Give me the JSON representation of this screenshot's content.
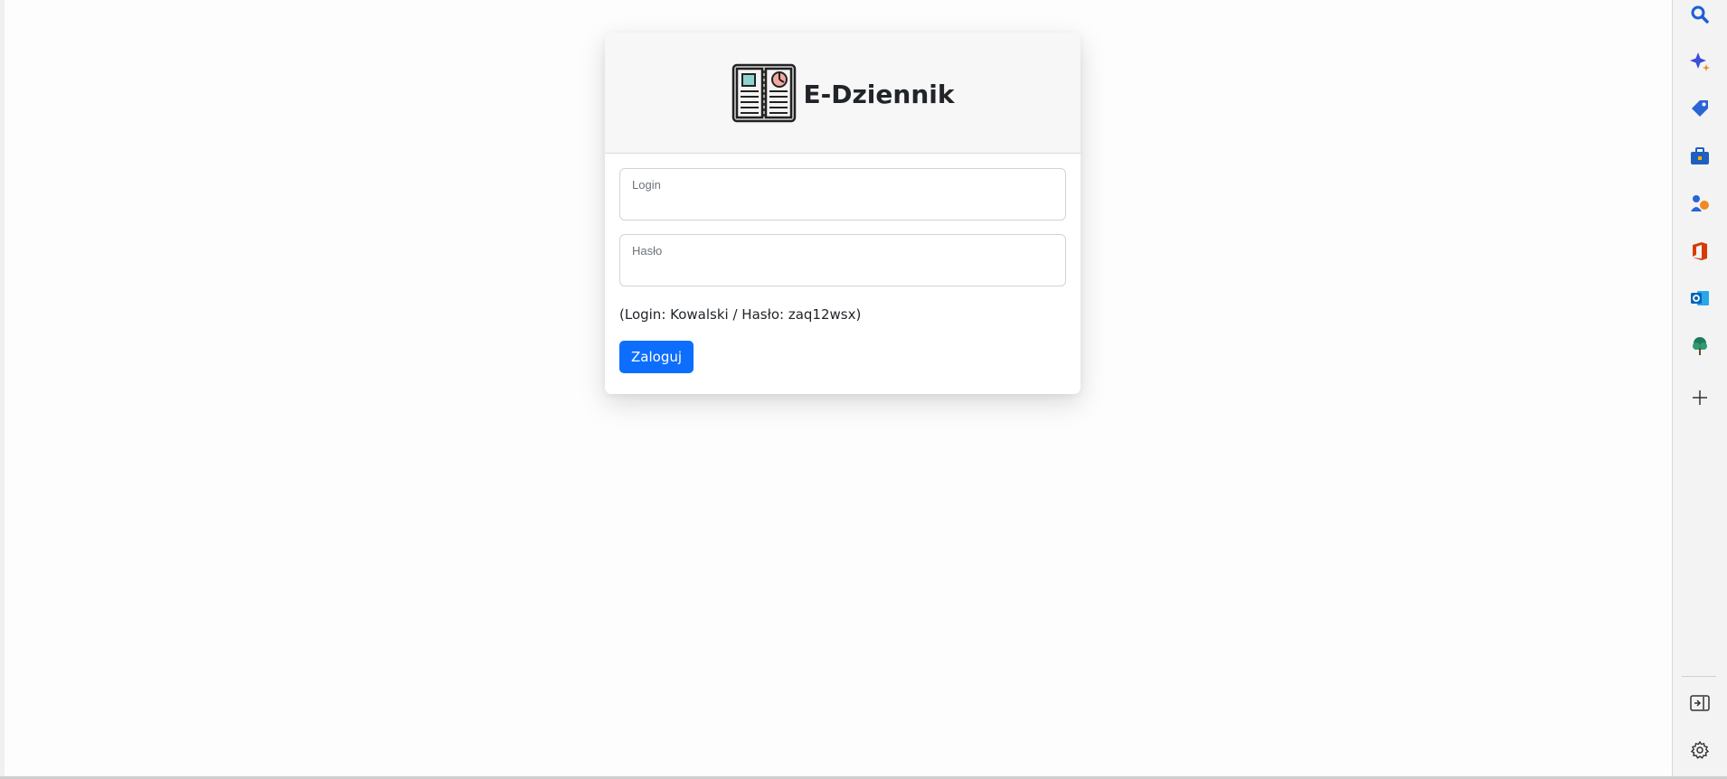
{
  "brand": {
    "title": "E-Dziennik"
  },
  "form": {
    "login_label": "Login",
    "password_label": "Hasło",
    "hint": "(Login: Kowalski / Hasło: zaq12wsx)",
    "submit_label": "Zaloguj"
  },
  "sidebar": {
    "items": [
      {
        "icon": "search-icon"
      },
      {
        "icon": "copilot-sparkle-icon"
      },
      {
        "icon": "shopping-tag-icon"
      },
      {
        "icon": "tools-briefcase-icon"
      },
      {
        "icon": "games-icon"
      },
      {
        "icon": "office-icon"
      },
      {
        "icon": "outlook-icon"
      },
      {
        "icon": "tree-icon"
      },
      {
        "icon": "add-icon"
      }
    ],
    "bottom": [
      {
        "icon": "hide-sidebar-icon"
      },
      {
        "icon": "settings-gear-icon"
      }
    ]
  },
  "colors": {
    "primary": "#0d6efd",
    "card_header_bg": "#f7f7f7"
  }
}
